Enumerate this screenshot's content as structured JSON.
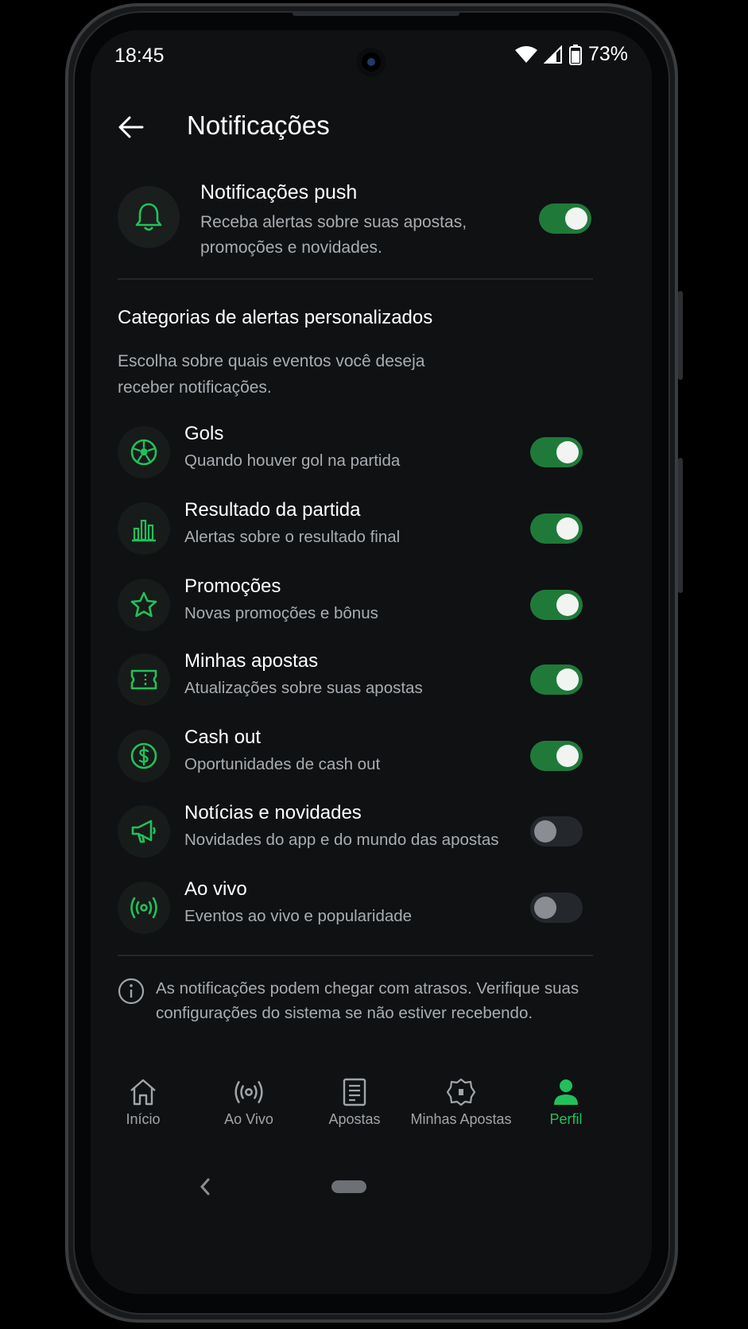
{
  "status_bar": {
    "time": "18:45",
    "battery": "73%",
    "icons": [
      "wifi-icon",
      "signal-icon",
      "battery-icon"
    ]
  },
  "header": {
    "title": "Notificações",
    "back_icon": "arrow-left-icon"
  },
  "push": {
    "title": "Notificações push",
    "description": "Receba alertas sobre suas apostas, promoções e novidades.",
    "icon": "bell-icon",
    "enabled": true
  },
  "section": {
    "title": "Categorias de alertas personalizados",
    "description": "Escolha sobre quais eventos você deseja receber notificações."
  },
  "categories": [
    {
      "title": "Gols",
      "subtitle": "Quando houver gol na partida",
      "icon": "soccer-ball-icon",
      "enabled": true
    },
    {
      "title": "Resultado da partida",
      "subtitle": "Alertas sobre o resultado final",
      "icon": "bar-chart-icon",
      "enabled": true
    },
    {
      "title": "Promoções",
      "subtitle": "Novas promoções e bônus",
      "icon": "star-icon",
      "enabled": true
    },
    {
      "title": "Minhas apostas",
      "subtitle": "Atualizações sobre suas apostas",
      "icon": "ticket-icon",
      "enabled": true
    },
    {
      "title": "Cash out",
      "subtitle": "Oportunidades de cash out",
      "icon": "dollar-coin-icon",
      "enabled": true
    },
    {
      "title": "Notícias e novidades",
      "subtitle": "Novidades do app e do mundo das apostas",
      "icon": "megaphone-icon",
      "enabled": false
    },
    {
      "title": "Ao vivo",
      "subtitle": "Eventos ao vivo e popularidade",
      "icon": "broadcast-icon",
      "enabled": false
    }
  ],
  "info": {
    "text": "As notificações podem chegar com atrasos. Verifique suas configurações do sistema se não estiver recebendo.",
    "icon": "info-icon"
  },
  "bottom_nav": [
    {
      "label": "Início",
      "icon": "home-icon",
      "active": false
    },
    {
      "label": "Ao Vivo",
      "icon": "broadcast-icon",
      "active": false
    },
    {
      "label": "Apostas",
      "icon": "document-icon",
      "active": false
    },
    {
      "label": "Minhas Apostas",
      "icon": "badge-icon",
      "active": false
    },
    {
      "label": "Perfil",
      "icon": "user-icon",
      "active": true
    }
  ],
  "colors": {
    "accent": "#22c05a",
    "toggle_on": "#1f7a3a",
    "background": "#0f1113",
    "muted_text": "#a8adb1"
  }
}
